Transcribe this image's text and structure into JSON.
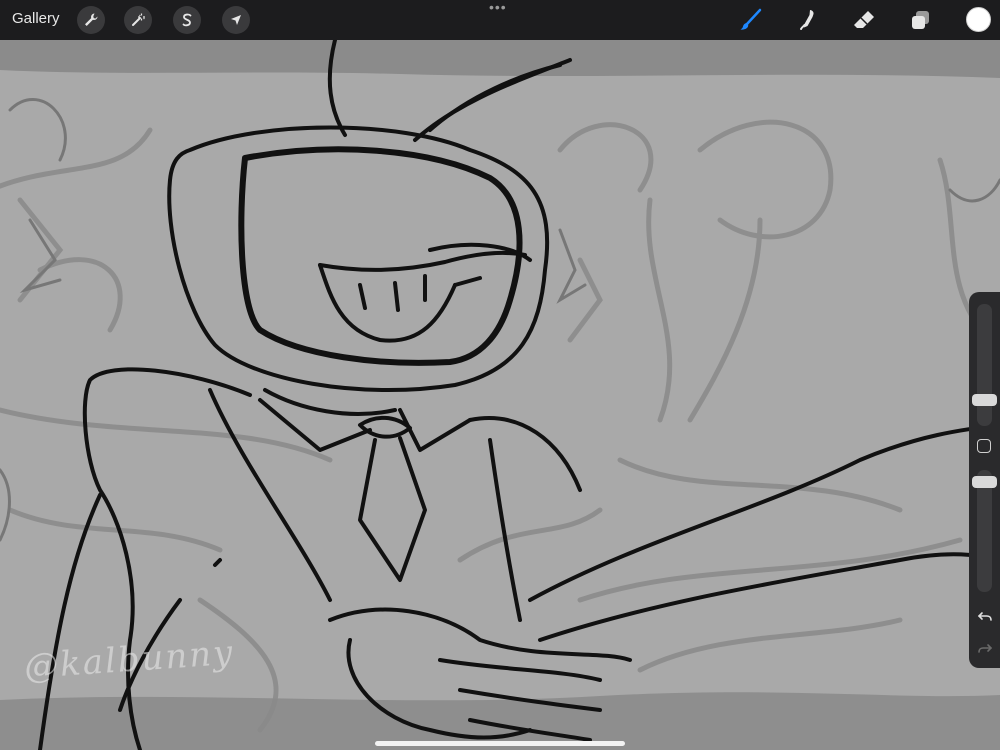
{
  "toolbar": {
    "gallery_label": "Gallery",
    "left_tools": [
      {
        "icon": "wrench-icon",
        "name": "actions-button"
      },
      {
        "icon": "magic-wand-icon",
        "name": "adjustments-button"
      },
      {
        "icon": "selection-s-icon",
        "name": "selection-button"
      },
      {
        "icon": "arrow-cursor-icon",
        "name": "transform-button"
      }
    ],
    "right_tools": [
      {
        "icon": "brush-icon",
        "name": "brush-button",
        "active": true
      },
      {
        "icon": "smudge-icon",
        "name": "smudge-button"
      },
      {
        "icon": "eraser-icon",
        "name": "eraser-button"
      },
      {
        "icon": "layers-icon",
        "name": "layers-button"
      }
    ],
    "active_color": "#ffffff",
    "accent_color": "#1e88ff"
  },
  "canvas": {
    "watermark": "@kalbunny"
  },
  "sidebar": {
    "brush_size": 0.3,
    "brush_opacity": 1.0,
    "icons": [
      "modify-square-icon",
      "undo-icon",
      "redo-icon"
    ]
  }
}
